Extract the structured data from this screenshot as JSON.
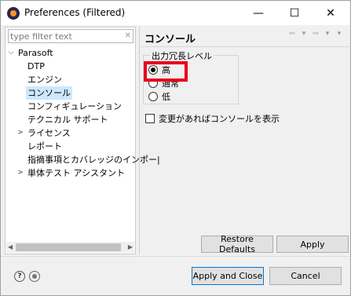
{
  "window": {
    "title": "Preferences (Filtered)",
    "minimize_glyph": "—",
    "maximize_glyph": "☐",
    "close_glyph": "✕"
  },
  "sidebar": {
    "filter_placeholder": "type filter text",
    "filter_value": "",
    "tree": [
      {
        "label": "Parasoft",
        "arrow": "⌵",
        "level": 0,
        "selected": false
      },
      {
        "label": "DTP",
        "arrow": "",
        "level": 1,
        "selected": false
      },
      {
        "label": "エンジン",
        "arrow": "",
        "level": 1,
        "selected": false
      },
      {
        "label": "コンソール",
        "arrow": "",
        "level": 1,
        "selected": true
      },
      {
        "label": "コンフィギュレーション",
        "arrow": "",
        "level": 1,
        "selected": false
      },
      {
        "label": "テクニカル サポート",
        "arrow": "",
        "level": 1,
        "selected": false
      },
      {
        "label": "ライセンス",
        "arrow": ">",
        "level": 1,
        "selected": false
      },
      {
        "label": "レポート",
        "arrow": "",
        "level": 1,
        "selected": false
      },
      {
        "label": "指摘事項とカバレッジのインポー|",
        "arrow": "",
        "level": 1,
        "selected": false
      },
      {
        "label": "単体テスト アシスタント",
        "arrow": ">",
        "level": 1,
        "selected": false
      }
    ]
  },
  "page": {
    "title": "コンソール",
    "nav": {
      "back": "⇦",
      "back_menu": "▾",
      "forward": "⇨",
      "forward_menu": "▾",
      "view_menu": "▾"
    },
    "verbosity_group": {
      "label": "出力冗長レベル",
      "options": [
        {
          "label": "高",
          "checked": true
        },
        {
          "label": "通常",
          "checked": false
        },
        {
          "label": "低",
          "checked": false
        }
      ]
    },
    "show_console_checkbox": {
      "label": "変更があればコンソールを表示",
      "checked": false
    },
    "restore_defaults_label": "Restore Defaults",
    "apply_label": "Apply"
  },
  "footer": {
    "help_glyph": "?",
    "apply_close_label": "Apply and Close",
    "cancel_label": "Cancel"
  },
  "colors": {
    "highlight": "#e8001c",
    "selection": "#cce8ff",
    "default_button_border": "#0078d7"
  }
}
